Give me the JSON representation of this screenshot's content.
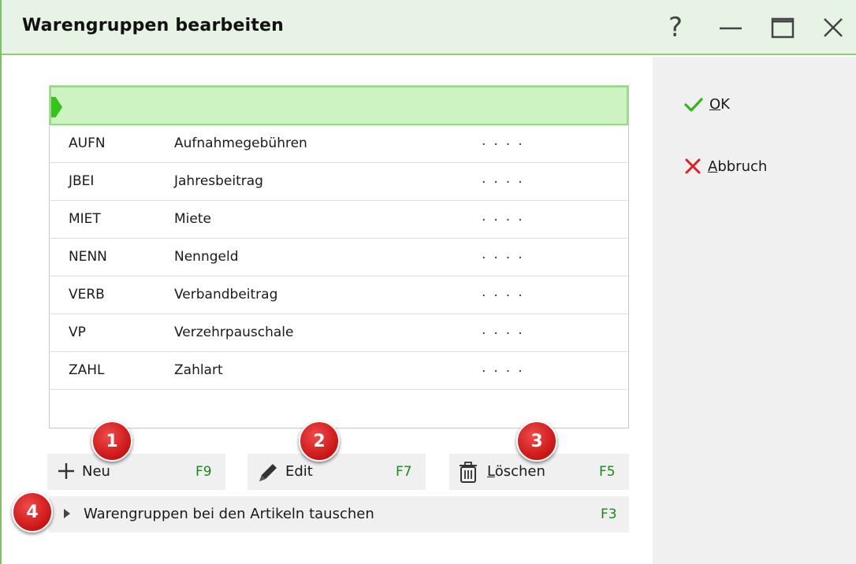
{
  "window": {
    "title": "Warengruppen bearbeiten",
    "help_glyph": "?"
  },
  "side": {
    "ok_accel": "O",
    "ok_rest": "K",
    "cancel_accel": "A",
    "cancel_rest": "bbruch"
  },
  "table": {
    "rows": [
      {
        "code": "AUFN",
        "name": "Aufnahmegebühren",
        "dots": "...."
      },
      {
        "code": "JBEI",
        "name": "Jahresbeitrag",
        "dots": "...."
      },
      {
        "code": "MIET",
        "name": "Miete",
        "dots": "...."
      },
      {
        "code": "NENN",
        "name": "Nenngeld",
        "dots": "...."
      },
      {
        "code": "VERB",
        "name": "Verbandbeitrag",
        "dots": "...."
      },
      {
        "code": "VP",
        "name": "Verzehrpauschale",
        "dots": "...."
      },
      {
        "code": "ZAHL",
        "name": "Zahlart",
        "dots": "...."
      }
    ]
  },
  "actions": {
    "new_label": "Neu",
    "new_key": "F9",
    "edit_label": "Edit",
    "edit_key": "F7",
    "delete_accel": "L",
    "delete_rest": "öschen",
    "delete_key": "F5",
    "swap_label": "Warengruppen bei den Artikeln tauschen",
    "swap_key": "F3"
  },
  "badges": [
    "1",
    "2",
    "3",
    "4"
  ],
  "colors": {
    "accent_green": "#35c51a",
    "highlight_row": "#cdf3c3",
    "key_green": "#1a8a1a",
    "badge_red": "#d61c1c",
    "cancel_red": "#e02020"
  }
}
